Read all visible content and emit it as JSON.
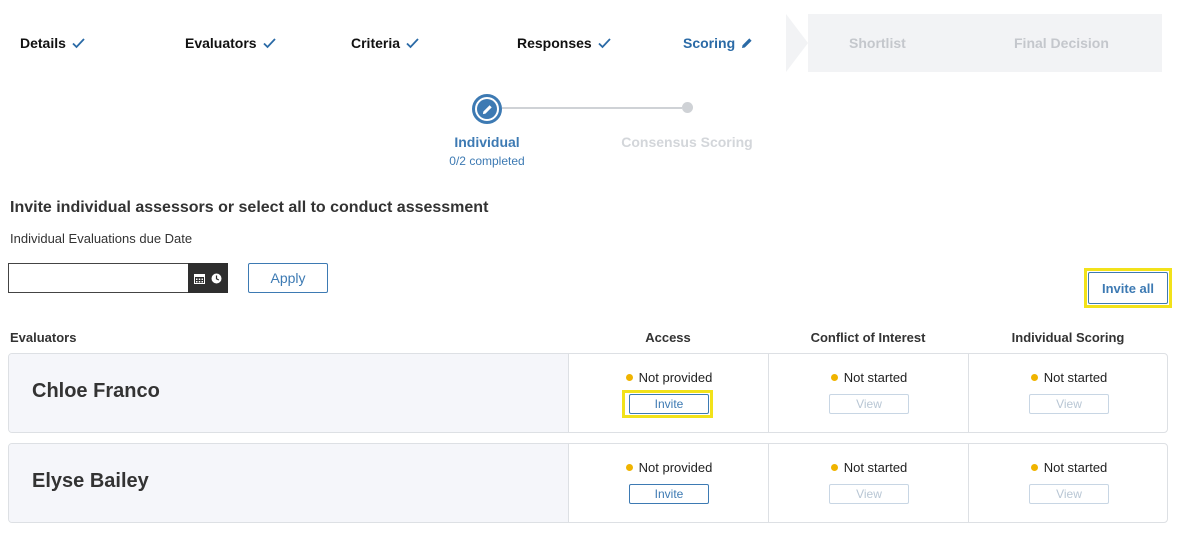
{
  "steps": {
    "details": "Details",
    "evaluators": "Evaluators",
    "criteria": "Criteria",
    "responses": "Responses",
    "scoring": "Scoring",
    "shortlist": "Shortlist",
    "final_decision": "Final Decision"
  },
  "sub_stepper": {
    "individual": "Individual",
    "individual_progress": "0/2 completed",
    "consensus": "Consensus Scoring"
  },
  "instructions": "Invite individual assessors or select all to conduct assessment",
  "due_date_label": "Individual Evaluations due Date",
  "due_date_value": "",
  "apply_label": "Apply",
  "invite_all_label": "Invite all",
  "columns": {
    "evaluators": "Evaluators",
    "access": "Access",
    "conflict": "Conflict of Interest",
    "scoring": "Individual Scoring"
  },
  "evaluators": [
    {
      "name": "Chloe Franco",
      "access_status": "Not provided",
      "access_button": "Invite",
      "conflict_status": "Not started",
      "conflict_button": "View",
      "scoring_status": "Not started",
      "scoring_button": "View"
    },
    {
      "name": "Elyse Bailey",
      "access_status": "Not provided",
      "access_button": "Invite",
      "conflict_status": "Not started",
      "conflict_button": "View",
      "scoring_status": "Not started",
      "scoring_button": "View"
    }
  ],
  "colors": {
    "accent": "#3d7ab3",
    "status_dot": "#f0b400",
    "highlight": "#f2e21a"
  }
}
